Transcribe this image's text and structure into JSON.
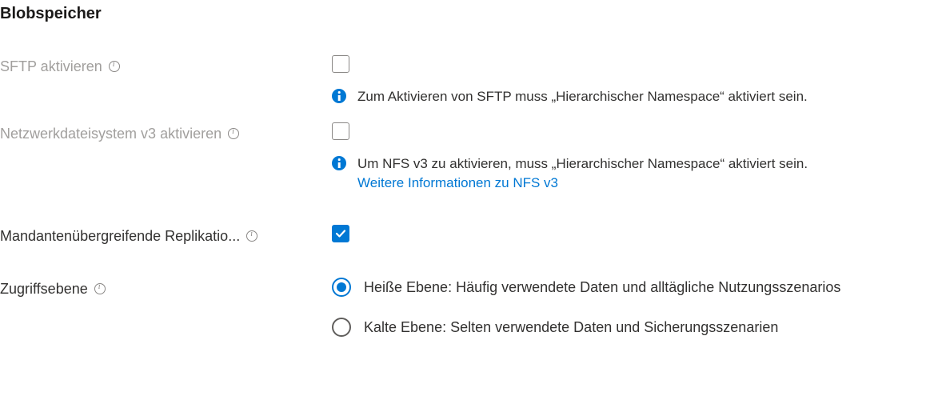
{
  "section": {
    "title": "Blobspeicher"
  },
  "fields": {
    "sftp": {
      "label": "SFTP aktivieren",
      "disabled": true,
      "checked": false,
      "info": "Zum Aktivieren von SFTP muss „Hierarchischer Namespace“ aktiviert sein."
    },
    "nfs": {
      "label": "Netzwerkdateisystem v3 aktivieren",
      "disabled": true,
      "checked": false,
      "info": "Um NFS v3 zu aktivieren, muss „Hierarchischer Namespace“ aktiviert sein.",
      "link": "Weitere Informationen zu NFS v3"
    },
    "crossTenant": {
      "label": "Mandantenübergreifende Replikatio...",
      "disabled": false,
      "checked": true
    },
    "accessTier": {
      "label": "Zugriffsebene",
      "options": {
        "hot": "Heiße Ebene: Häufig verwendete Daten und alltägliche Nutzungsszenarios",
        "cool": "Kalte Ebene: Selten verwendete Daten und Sicherungsszenarien"
      },
      "selected": "hot"
    }
  }
}
